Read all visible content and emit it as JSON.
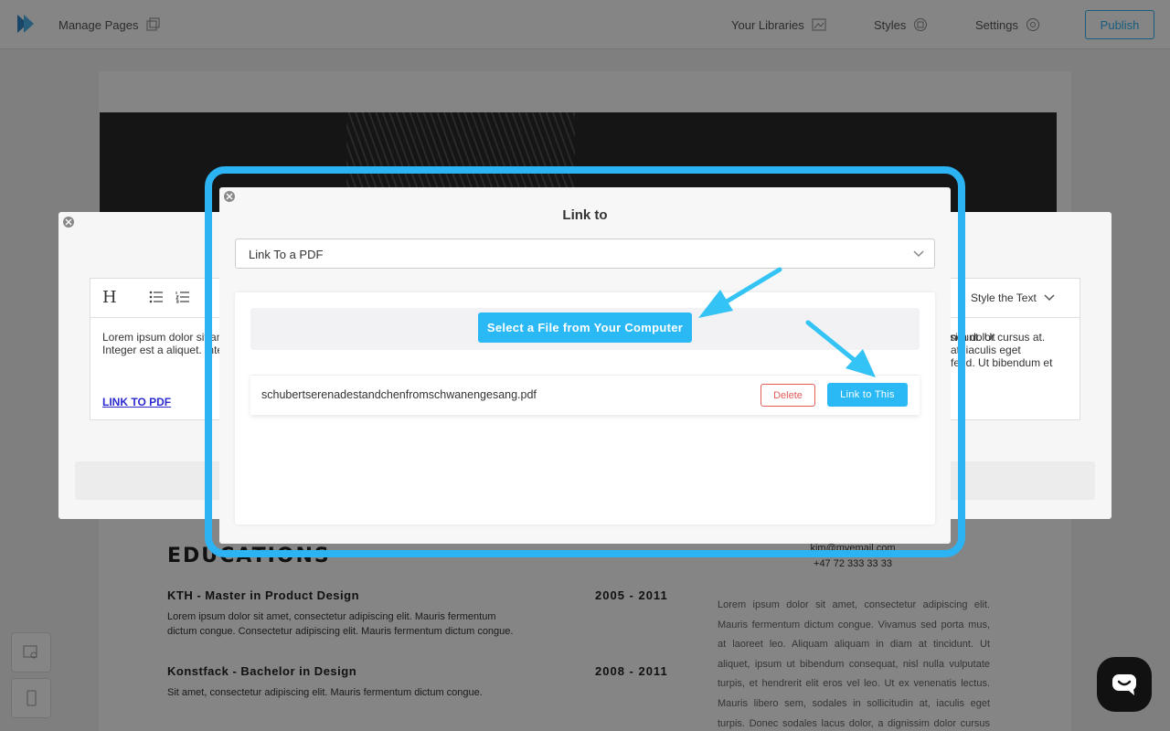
{
  "topbar": {
    "manage_pages": "Manage Pages",
    "your_libraries": "Your Libraries",
    "styles": "Styles",
    "settings": "Settings",
    "publish": "Publish"
  },
  "page": {
    "edu_title": "EDUCATIONS",
    "edu1": {
      "title": "KTH - Master in Product Design",
      "years": "2005 - 2011",
      "text": "Lorem ipsum dolor sit amet, consectetur adipiscing elit. Mauris fermentum dictum congue. Consectetur adipiscing elit. Mauris fermentum dictum congue."
    },
    "edu2": {
      "title": "Konstfack - Bachelor in Design",
      "years": "2008 - 2011",
      "text": "Sit amet, consectetur adipiscing elit. Mauris fermentum dictum congue."
    },
    "email": "kim@myemail.com",
    "phone": "+47 72 333 33 33",
    "right_para": "Lorem ipsum dolor sit amet, consectetur adipiscing elit. Mauris fermentum dictum congue. Vivamus sed porta mus, at laoreet leo. Aliquam aliquam in diam at tincidunt. Ut aliquet, ipsum ut bibendum consequat, nisl nulla vulputate turpis, et hendrerit elit eros vel leo. Ut ex venenatis lectus. Mauris libero sem, sodales in sollicitudin at, iaculis eget turpis. Donec sodales lacus dolor, a dignissim dolor cursus at. Donec at"
  },
  "editor": {
    "heading_tool": "H",
    "style_text": "Style the Text",
    "body_left": "Lorem ipsum dolor sit amet, consectetur adipiscing elit. Maecenas ac adipiscing, mauris et bibendum consequat, nisl nulla vulputate turpis. Donec sodales lacus dolor, a dignissim dolor cursus at. Integer est a aliquet. Integer eget nisl.",
    "body_right": "ndunt. Ut\nat, iaculis eget\nfend. Ut bibendum et",
    "link_text": "LINK TO PDF"
  },
  "link_modal": {
    "title": "Link to",
    "select_value": "Link To a PDF",
    "upload_button": "Select a File from Your Computer",
    "file_name": "schubertserenadestandchenfromschwanengesang.pdf",
    "delete_button": "Delete",
    "link_button": "Link to This"
  },
  "colors": {
    "accent": "#2bb3f3",
    "delete": "#e35a5a",
    "link": "#2a2ad0"
  }
}
